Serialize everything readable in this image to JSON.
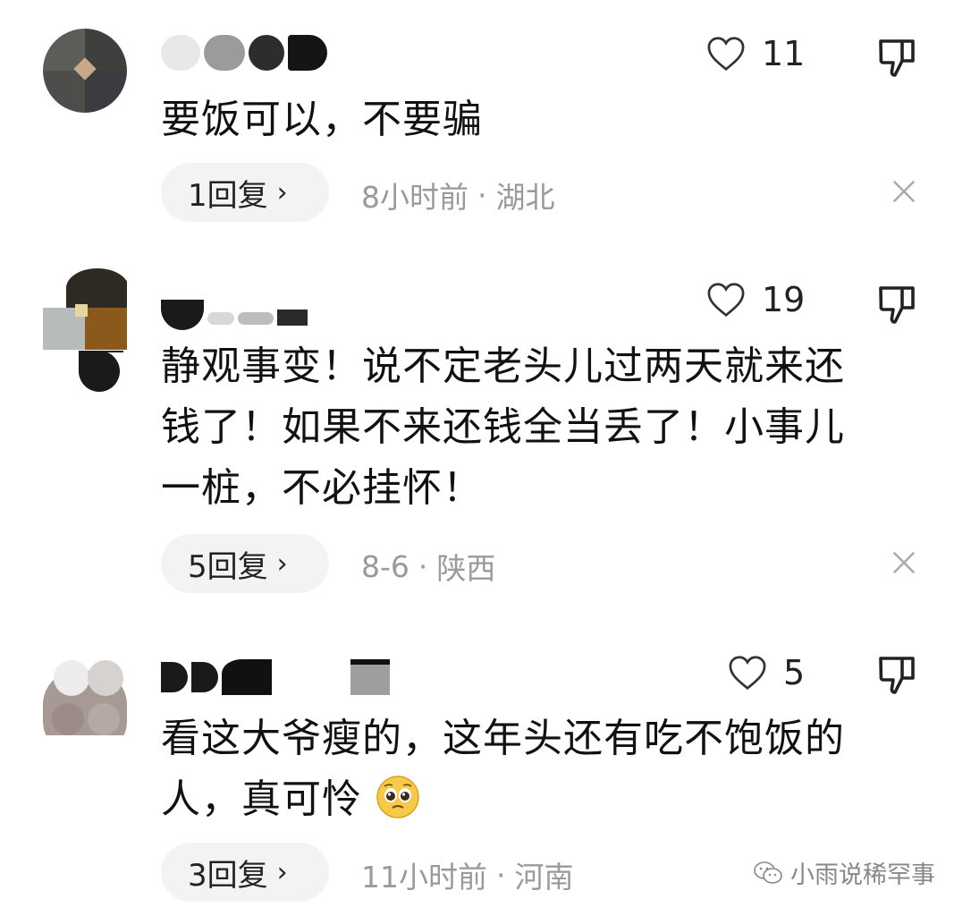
{
  "comments": [
    {
      "text": "要饭可以，不要骗",
      "likes": "11",
      "reply_label": "1回复",
      "time": "8小时前",
      "location": "湖北"
    },
    {
      "text_lines": [
        "静观事变！说不定老头儿过两天就来还",
        "钱了！如果不来还钱全当丢了！小事儿",
        "一桩，不必挂怀！"
      ],
      "likes": "19",
      "reply_label": "5回复",
      "time": "8-6",
      "location": "陕西"
    },
    {
      "text_lines": [
        "看这大爷瘦的，这年头还有吃不饱饭的",
        "人，真可怜"
      ],
      "likes": "5",
      "reply_label": "3回复",
      "time": "11小时前",
      "location": "河南"
    }
  ],
  "separator": "·",
  "chevron": "›",
  "watermark": "小雨说稀罕事",
  "icons": {
    "like": "heart-outline-icon",
    "dislike": "thumbs-down-icon",
    "close": "close-icon",
    "emoji": "pleading-face-emoji",
    "watermark": "wechat-icon"
  },
  "colors": {
    "meta_gray": "#9a9a9a",
    "pill_bg": "#f3f3f3",
    "text": "#111111"
  }
}
